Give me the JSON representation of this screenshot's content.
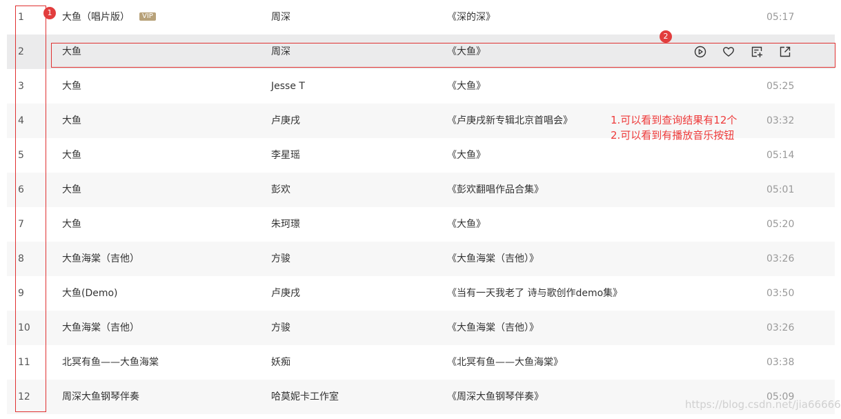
{
  "songs": [
    {
      "index": "1",
      "title": "大鱼（唱片版）",
      "vip": "VIP",
      "artist": "周深",
      "album": "《深的深》",
      "duration": "05:17"
    },
    {
      "index": "2",
      "title": "大鱼",
      "artist": "周深",
      "album": "《大鱼》",
      "duration": ""
    },
    {
      "index": "3",
      "title": "大鱼",
      "artist": "Jesse T",
      "album": "《大鱼》",
      "duration": "05:25"
    },
    {
      "index": "4",
      "title": "大鱼",
      "artist": "卢庚戌",
      "album": "《卢庚戌新专辑北京首唱会》",
      "duration": "03:32"
    },
    {
      "index": "5",
      "title": "大鱼",
      "artist": "李星瑶",
      "album": "《大鱼》",
      "duration": "05:14"
    },
    {
      "index": "6",
      "title": "大鱼",
      "artist": "彭欢",
      "album": "《彭欢翻唱作品合集》",
      "duration": "05:01"
    },
    {
      "index": "7",
      "title": "大鱼",
      "artist": "朱珂璟",
      "album": "《大鱼》",
      "duration": "05:20"
    },
    {
      "index": "8",
      "title": "大鱼海棠（吉他）",
      "artist": "方骏",
      "album": "《大鱼海棠（吉他）》",
      "duration": "03:26"
    },
    {
      "index": "9",
      "title": "大鱼(Demo)",
      "artist": "卢庚戌",
      "album": "《当有一天我老了 诗与歌创作demo集》",
      "duration": "03:50"
    },
    {
      "index": "10",
      "title": "大鱼海棠（吉他）",
      "artist": "方骏",
      "album": "《大鱼海棠（吉他）》",
      "duration": "03:26"
    },
    {
      "index": "11",
      "title": "北冥有鱼——大鱼海棠",
      "artist": "妖痴",
      "album": "《北冥有鱼——大鱼海棠》",
      "duration": "03:38"
    },
    {
      "index": "12",
      "title": "周深大鱼钢琴伴奏",
      "artist": "哈莫妮卡工作室",
      "album": "《周深大鱼钢琴伴奏》",
      "duration": "05:09"
    }
  ],
  "hover_actions": [
    {
      "icon": "play-icon"
    },
    {
      "icon": "heart-icon"
    },
    {
      "icon": "add-to-list-icon"
    },
    {
      "icon": "share-icon"
    }
  ],
  "annotations": {
    "badge1": "1",
    "badge2": "2",
    "note_line1": "1.可以看到查询结果有12个",
    "note_line2": "2.可以看到有播放音乐按钮",
    "color": "#e03030"
  },
  "watermark": "https://blog.csdn.net/jia666666"
}
